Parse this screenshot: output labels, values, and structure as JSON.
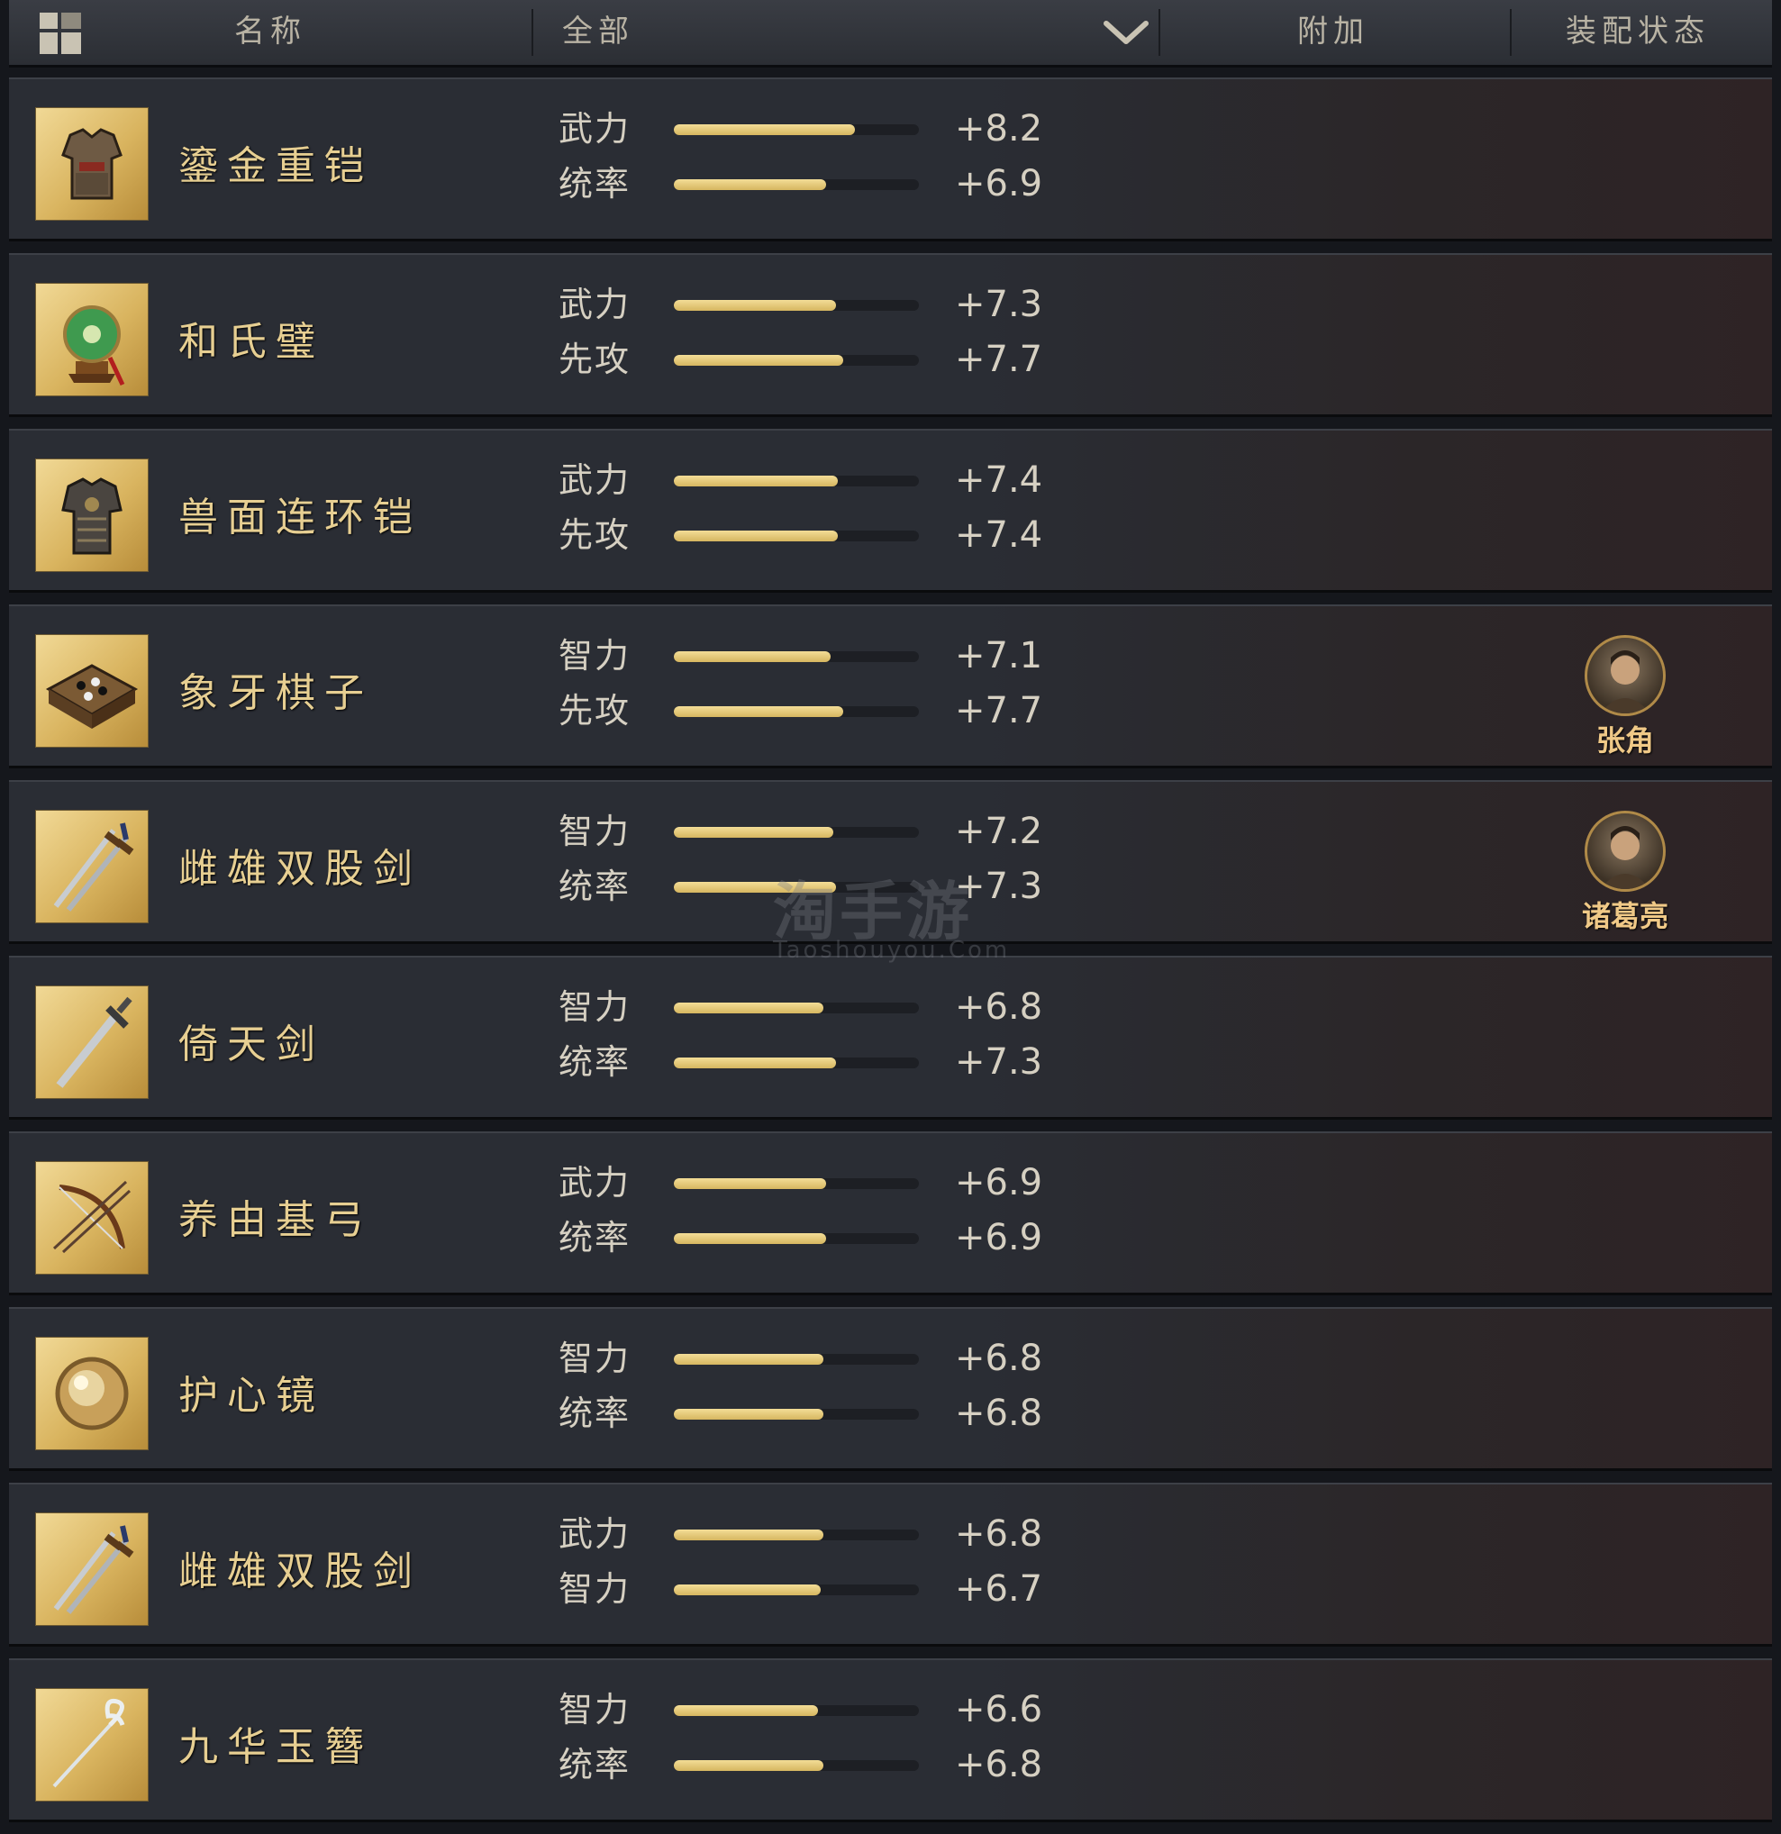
{
  "header": {
    "name_label": "名称",
    "filter_value": "全部",
    "bonus_label": "附加",
    "equip_label": "装配状态"
  },
  "watermark": {
    "text": "淘手游",
    "subtext": "Taoshouyou.Com"
  },
  "items": [
    {
      "name": "鎏金重铠",
      "icon": "armor-icon",
      "stats": [
        {
          "label": "武力",
          "value": "+8.2",
          "fill": 0.74
        },
        {
          "label": "统率",
          "value": "+6.9",
          "fill": 0.62
        }
      ],
      "equipped_by": ""
    },
    {
      "name": "和氏璧",
      "icon": "jade-disc-icon",
      "stats": [
        {
          "label": "武力",
          "value": "+7.3",
          "fill": 0.66
        },
        {
          "label": "先攻",
          "value": "+7.7",
          "fill": 0.69
        }
      ],
      "equipped_by": ""
    },
    {
      "name": "兽面连环铠",
      "icon": "chain-armor-icon",
      "stats": [
        {
          "label": "武力",
          "value": "+7.4",
          "fill": 0.67
        },
        {
          "label": "先攻",
          "value": "+7.4",
          "fill": 0.67
        }
      ],
      "equipped_by": ""
    },
    {
      "name": "象牙棋子",
      "icon": "go-board-icon",
      "stats": [
        {
          "label": "智力",
          "value": "+7.1",
          "fill": 0.64
        },
        {
          "label": "先攻",
          "value": "+7.7",
          "fill": 0.69
        }
      ],
      "equipped_by": "张角"
    },
    {
      "name": "雌雄双股剑",
      "icon": "twin-swords-icon",
      "stats": [
        {
          "label": "智力",
          "value": "+7.2",
          "fill": 0.65
        },
        {
          "label": "统率",
          "value": "+7.3",
          "fill": 0.66
        }
      ],
      "equipped_by": "诸葛亮"
    },
    {
      "name": "倚天剑",
      "icon": "sword-icon",
      "stats": [
        {
          "label": "智力",
          "value": "+6.8",
          "fill": 0.61
        },
        {
          "label": "统率",
          "value": "+7.3",
          "fill": 0.66
        }
      ],
      "equipped_by": ""
    },
    {
      "name": "养由基弓",
      "icon": "bow-icon",
      "stats": [
        {
          "label": "武力",
          "value": "+6.9",
          "fill": 0.62
        },
        {
          "label": "统率",
          "value": "+6.9",
          "fill": 0.62
        }
      ],
      "equipped_by": ""
    },
    {
      "name": "护心镜",
      "icon": "mirror-shield-icon",
      "stats": [
        {
          "label": "智力",
          "value": "+6.8",
          "fill": 0.61
        },
        {
          "label": "统率",
          "value": "+6.8",
          "fill": 0.61
        }
      ],
      "equipped_by": ""
    },
    {
      "name": "雌雄双股剑",
      "icon": "twin-swords-icon",
      "stats": [
        {
          "label": "武力",
          "value": "+6.8",
          "fill": 0.61
        },
        {
          "label": "智力",
          "value": "+6.7",
          "fill": 0.6
        }
      ],
      "equipped_by": ""
    },
    {
      "name": "九华玉簪",
      "icon": "hairpin-icon",
      "stats": [
        {
          "label": "智力",
          "value": "+6.6",
          "fill": 0.59
        },
        {
          "label": "统率",
          "value": "+6.8",
          "fill": 0.61
        }
      ],
      "equipped_by": ""
    }
  ],
  "colors": {
    "bar_fill": "#e8cf86",
    "item_name": "#e7cf92",
    "equip_name": "#f0c987"
  }
}
